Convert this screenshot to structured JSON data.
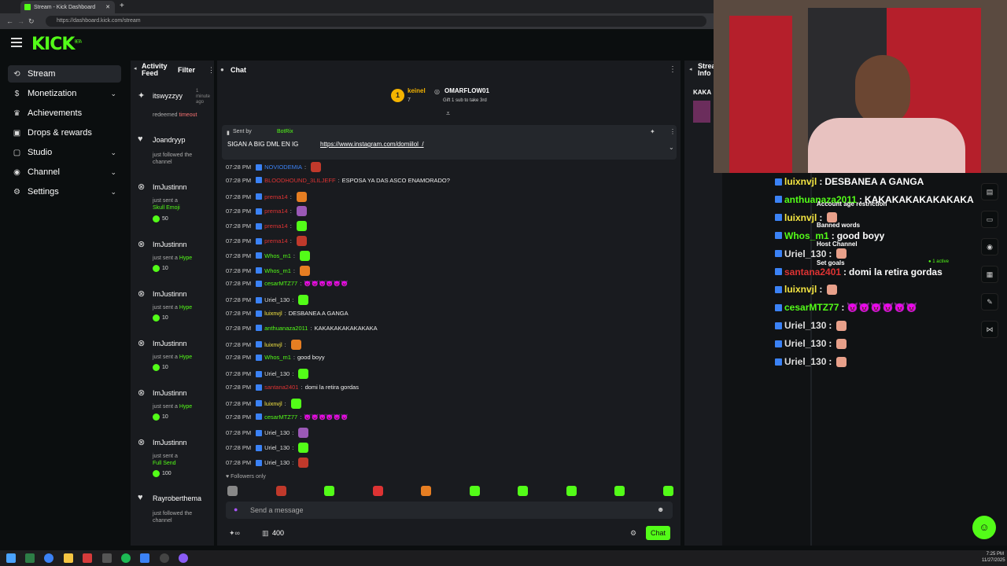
{
  "browser": {
    "tab_title": "Stream - Kick Dashboard",
    "url": "https://dashboard.kick.com/stream"
  },
  "brand": {
    "logo": "KICK",
    "logo_suffix": "BETA",
    "accent": "#53fc18"
  },
  "sidebar": {
    "items": [
      {
        "label": "Stream",
        "icon": "stream-icon",
        "active": true
      },
      {
        "label": "Monetization",
        "icon": "dollar-icon",
        "expandable": true
      },
      {
        "label": "Achievements",
        "icon": "trophy-icon"
      },
      {
        "label": "Drops & rewards",
        "icon": "gift-icon"
      },
      {
        "label": "Studio",
        "icon": "studio-icon",
        "expandable": true
      },
      {
        "label": "Channel",
        "icon": "user-icon",
        "expandable": true
      },
      {
        "label": "Settings",
        "icon": "gear-icon",
        "expandable": true
      }
    ]
  },
  "activity": {
    "title": "Activity Feed",
    "filter": "Filter",
    "items": [
      {
        "name": "itswyzzyy",
        "time": "1 minute ago",
        "text": "redeemed ",
        "highlight": "timeout",
        "icon": "sparkle-icon"
      },
      {
        "name": "Joandryyp",
        "time": "",
        "text": "just followed the channel",
        "highlight": "",
        "icon": "heart-icon"
      },
      {
        "name": "ImJustinnn",
        "time": "minute",
        "text": "just sent a ",
        "highlight": "Skull Emoji",
        "amount": "50",
        "icon": "kick-icon"
      },
      {
        "name": "ImJustinnn",
        "time": "minute",
        "text": "just sent a ",
        "highlight": "Hype",
        "amount": "10",
        "icon": "kick-icon"
      },
      {
        "name": "ImJustinnn",
        "time": "minute",
        "text": "just sent a ",
        "highlight": "Hype",
        "amount": "10",
        "icon": "kick-icon"
      },
      {
        "name": "ImJustinnn",
        "time": "minute",
        "text": "just sent a ",
        "highlight": "Hype",
        "amount": "10",
        "icon": "kick-icon"
      },
      {
        "name": "ImJustinnn",
        "time": "minute",
        "text": "just sent a ",
        "highlight": "Hype",
        "amount": "10",
        "icon": "kick-icon"
      },
      {
        "name": "ImJustinnn",
        "time": "minute",
        "text": "just sent a ",
        "highlight": "Full Send",
        "amount": "100",
        "icon": "kick-icon"
      },
      {
        "name": "Rayroberthema",
        "time": "",
        "text": "just followed the channel",
        "highlight": "",
        "icon": "heart-icon"
      }
    ]
  },
  "chat": {
    "title": "Chat",
    "leaderboard": {
      "rank": "1",
      "user1": "keinel",
      "count1": "7",
      "user2": "OMARFLOW01",
      "gift_text": "Gift 1 sub to take 3rd"
    },
    "pinned": {
      "sender_label": "Sent by",
      "sender": "BotRix",
      "text": "SIGAN A BIG DML EN IG",
      "link": "https://www.instagram.com/domiilol_/"
    },
    "messages": [
      {
        "time": "07:28 PM",
        "user": "NOVIODEMIA",
        "color": "#3b82f6",
        "text": ""
      },
      {
        "time": "07:28 PM",
        "user": "BLOODHOUND_3LILJEFF",
        "color": "#d33",
        "text": "ESPOSA YA DAS ASCO ENAMORADO?"
      },
      {
        "time": "07:28 PM",
        "user": "prema14",
        "color": "#d33",
        "text": ""
      },
      {
        "time": "07:28 PM",
        "user": "prema14",
        "color": "#d33",
        "text": ""
      },
      {
        "time": "07:28 PM",
        "user": "prema14",
        "color": "#d33",
        "text": ""
      },
      {
        "time": "07:28 PM",
        "user": "prema14",
        "color": "#d33",
        "text": ""
      },
      {
        "time": "07:28 PM",
        "user": "Whos_m1",
        "color": "#53fc18",
        "text": ""
      },
      {
        "time": "07:28 PM",
        "user": "Whos_m1",
        "color": "#53fc18",
        "text": ""
      },
      {
        "time": "07:28 PM",
        "user": "cesarMTZ77",
        "color": "#53fc18",
        "text": "😈😈😈😈😈😈"
      },
      {
        "time": "07:28 PM",
        "user": "Uriel_130",
        "color": "#ddd",
        "text": ""
      },
      {
        "time": "07:28 PM",
        "user": "luixnvjl",
        "color": "#f5e642",
        "text": "DESBANEA A GANGA"
      },
      {
        "time": "07:28 PM",
        "user": "anthuanaza2011",
        "color": "#53fc18",
        "text": "KAKAKAKAKAKAKAKA"
      },
      {
        "time": "07:28 PM",
        "user": "luixnvjl",
        "color": "#f5e642",
        "text": ""
      },
      {
        "time": "07:28 PM",
        "user": "Whos_m1",
        "color": "#53fc18",
        "text": "good boyy"
      },
      {
        "time": "07:28 PM",
        "user": "Uriel_130",
        "color": "#ddd",
        "text": ""
      },
      {
        "time": "07:28 PM",
        "user": "santana2401",
        "color": "#d33",
        "text": "domi la retira gordas"
      },
      {
        "time": "07:28 PM",
        "user": "luixnvjl",
        "color": "#f5e642",
        "text": ""
      },
      {
        "time": "07:28 PM",
        "user": "cesarMTZ77",
        "color": "#53fc18",
        "text": "😈😈😈😈😈😈"
      },
      {
        "time": "07:28 PM",
        "user": "Uriel_130",
        "color": "#ddd",
        "text": ""
      },
      {
        "time": "07:28 PM",
        "user": "Uriel_130",
        "color": "#ddd",
        "text": ""
      },
      {
        "time": "07:28 PM",
        "user": "Uriel_130",
        "color": "#ddd",
        "text": ""
      }
    ],
    "mode": "Followers only",
    "input_placeholder": "Send a message",
    "points": "400",
    "send_label": "Chat"
  },
  "stream_info": {
    "title": "Stream Info",
    "preview_text": "KAKA"
  },
  "overlay": {
    "messages": [
      {
        "user": "luixnvjl",
        "color": "#f5e642",
        "text": "DESBANEA A GANGA"
      },
      {
        "user": "anthuanaza2011",
        "color": "#53fc18",
        "text": "KAKAKAKAKAKAKAKA"
      },
      {
        "user": "luixnvjl",
        "color": "#f5e642",
        "text": ""
      },
      {
        "user": "Whos_m1",
        "color": "#53fc18",
        "text": "good boyy"
      },
      {
        "user": "Uriel_130",
        "color": "#ddd",
        "text": ""
      },
      {
        "user": "santana2401",
        "color": "#d33",
        "text": "domi la retira gordas"
      },
      {
        "user": "luixnvjl",
        "color": "#f5e642",
        "text": ""
      },
      {
        "user": "cesarMTZ77",
        "color": "#53fc18",
        "text": "😈😈😈😈😈😈"
      },
      {
        "user": "Uriel_130",
        "color": "#ddd",
        "text": ""
      },
      {
        "user": "Uriel_130",
        "color": "#ddd",
        "text": ""
      },
      {
        "user": "Uriel_130",
        "color": "#ddd",
        "text": ""
      }
    ],
    "menu": {
      "age": "Account age restriction",
      "banned": "Banned words",
      "host": "Host Channel",
      "goals": "Set goals",
      "active": "1 active"
    }
  },
  "taskbar": {
    "time": "7:25 PM",
    "date": "11/27/2025"
  }
}
